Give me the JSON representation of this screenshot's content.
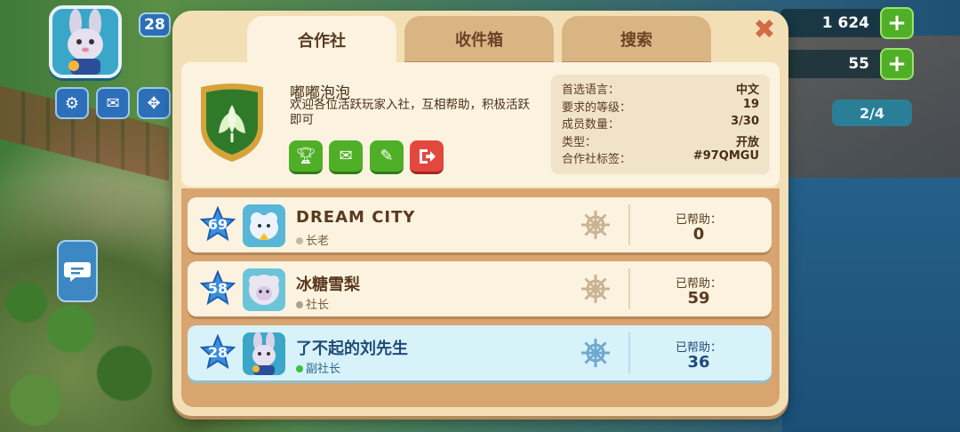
{
  "hud": {
    "player_level": "28",
    "coins": "1 624",
    "gems": "55",
    "progress": "2/4",
    "plus_symbol": "+"
  },
  "tabs": [
    {
      "label": "合作社",
      "active": true
    },
    {
      "label": "收件箱",
      "active": false
    },
    {
      "label": "搜索",
      "active": false
    }
  ],
  "close_symbol": "✖",
  "club": {
    "name": "嘟嘟泡泡",
    "description": "欢迎各位活跃玩家入社，互相帮助，积极活跃即可",
    "info": [
      {
        "label": "首选语言：",
        "value": "中文"
      },
      {
        "label": "要求的等级：",
        "value": "19"
      },
      {
        "label": "成员数量：",
        "value": "3/30"
      },
      {
        "label": "类型：",
        "value": "开放"
      },
      {
        "label": "合作社标签：",
        "value": "#97QMGU"
      }
    ]
  },
  "members": [
    {
      "level": "69",
      "name": "DREAM CITY",
      "role": "长老",
      "help_label": "已帮助：",
      "helped": "0",
      "highlight": false
    },
    {
      "level": "58",
      "name": "冰糖雪梨",
      "role": "社长",
      "help_label": "已帮助：",
      "helped": "59",
      "highlight": false
    },
    {
      "level": "28",
      "name": "了不起的刘先生",
      "role": "副社长",
      "help_label": "已帮助：",
      "helped": "36",
      "highlight": true
    }
  ],
  "colors": {
    "panel": "#f3dfb6",
    "tab_active": "#fbf3e0",
    "tab_inactive": "#d9b584",
    "green_button": "#4fb028",
    "red_button": "#e2483e",
    "level_star": "#3a8fe0",
    "highlight_row": "#d8f2fa"
  }
}
